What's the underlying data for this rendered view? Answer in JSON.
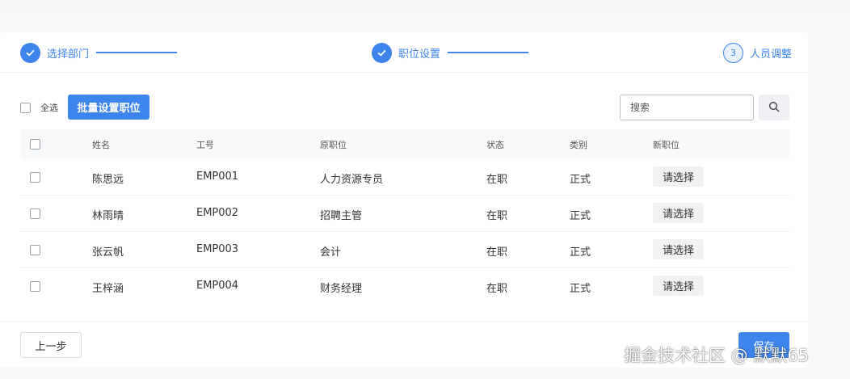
{
  "steps": [
    {
      "label": "选择部门",
      "state": "done"
    },
    {
      "label": "职位设置",
      "state": "done"
    },
    {
      "label": "人员调整",
      "state": "current",
      "number": "3"
    }
  ],
  "toolbar": {
    "select_all_label": "全选",
    "batch_button_label": "批量设置职位",
    "search_placeholder": "搜索"
  },
  "table": {
    "headers": [
      "姓名",
      "工号",
      "原职位",
      "状态",
      "类别",
      "新职位"
    ],
    "rows": [
      {
        "name": "陈思远",
        "id": "EMP001",
        "position": "人力资源专员",
        "status": "在职",
        "type": "正式",
        "new_position": "请选择"
      },
      {
        "name": "林雨晴",
        "id": "EMP002",
        "position": "招聘主管",
        "status": "在职",
        "type": "正式",
        "new_position": "请选择"
      },
      {
        "name": "张云帆",
        "id": "EMP003",
        "position": "会计",
        "status": "在职",
        "type": "正式",
        "new_position": "请选择"
      },
      {
        "name": "王梓涵",
        "id": "EMP004",
        "position": "财务经理",
        "status": "在职",
        "type": "正式",
        "new_position": "请选择"
      }
    ]
  },
  "footer": {
    "prev_label": "上一步",
    "save_label": "保存"
  },
  "watermark": "掘金技术社区 @ 默默65",
  "colors": {
    "accent": "#3d85ec",
    "background": "#f7f8fa"
  }
}
